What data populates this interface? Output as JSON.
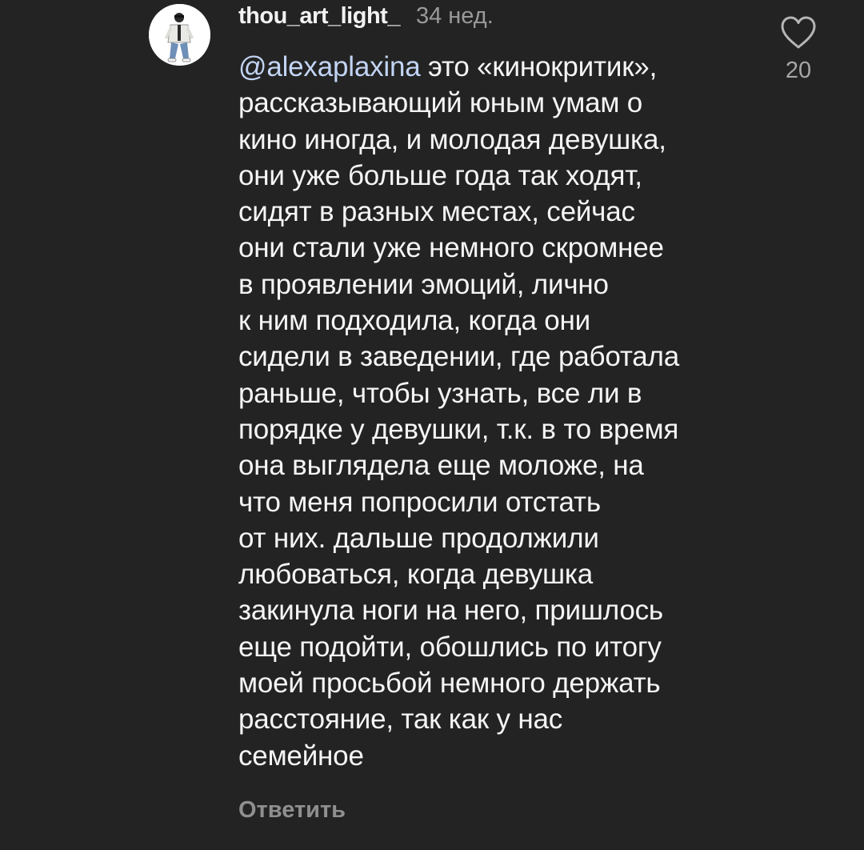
{
  "comment": {
    "username": "thou_art_light_",
    "timestamp": "34 нед.",
    "mention": "@alexaplaxina",
    "text_lines": [
      " это «кинокритик»,",
      "рассказывающий юным умам о",
      "кино иногда, и молодая девушка,",
      "они уже больше года так ходят,",
      "сидят в разных местах, сейчас",
      "они стали уже немного скромнее",
      "в проявлении эмоций, лично",
      "к ним подходила, когда они",
      "сидели в заведении, где работала",
      "раньше, чтобы узнать, все ли в",
      "порядке у девушки, т.к. в то время",
      "она выглядела еще моложе, на",
      "что меня попросили отстать",
      "от них. дальше продолжили",
      "любоваться, когда девушка",
      "закинула ноги на него, пришлось",
      "еще подойти, обошлись по итогу",
      "моей просьбой немного держать",
      "расстояние, так как у нас",
      "семейное"
    ],
    "reply_label": "Ответить",
    "like_count": "20"
  },
  "icons": {
    "avatar": "user-avatar",
    "like": "heart-outline-icon"
  },
  "colors": {
    "background": "#232323",
    "text": "#f5f5f5",
    "mention": "#c2d4f4",
    "muted": "#9a9a9a"
  }
}
